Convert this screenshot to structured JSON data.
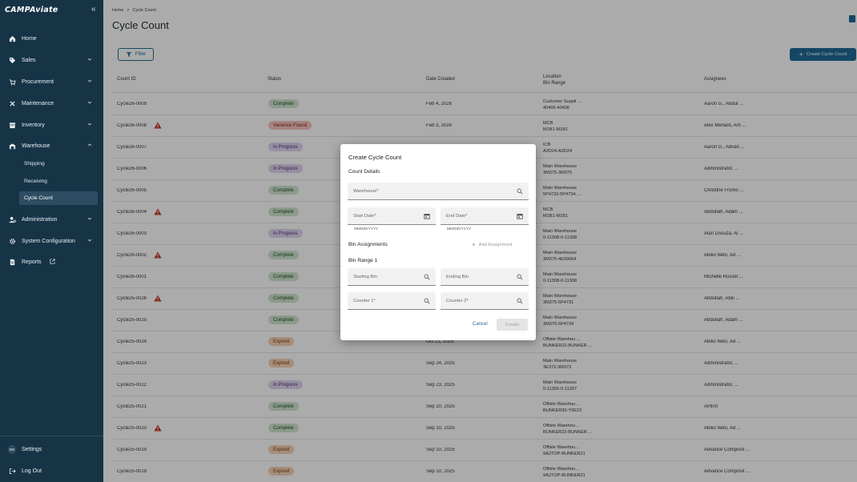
{
  "sidebar": {
    "logo_text": "CAMPAviate",
    "collapse_icon": "double-chevron-left-icon",
    "items": [
      {
        "label": "Home",
        "icon": "home-icon"
      },
      {
        "label": "Sales",
        "icon": "tag-icon"
      },
      {
        "label": "Procurement",
        "icon": "cart-icon"
      },
      {
        "label": "Maintenance",
        "icon": "tools-icon"
      },
      {
        "label": "Inventory",
        "icon": "inventory-icon"
      },
      {
        "label": "Warehouse",
        "icon": "warehouse-icon"
      }
    ],
    "warehouse_sub": [
      "Shipping",
      "Receiving",
      "Cycle Count"
    ],
    "items_after": [
      {
        "label": "Administration",
        "icon": "admin-icon"
      },
      {
        "label": "System Configuration",
        "icon": "gear-icon"
      },
      {
        "label": "Reports",
        "icon": "report-icon"
      }
    ],
    "settings_label": "Settings",
    "settings_avatar": "DS",
    "logout_label": "Log Out"
  },
  "breadcrumb": {
    "home": "Home",
    "sep": ">",
    "current": "Cycle Count"
  },
  "page_title": "Cycle Count",
  "toolbar": {
    "filter_label": "Filter",
    "create_label": "Create Cycle Count"
  },
  "table": {
    "headers": {
      "count_id": "Count ID",
      "status": "Status",
      "date_created": "Date Created",
      "location": "Location",
      "bin_range": "Bin Range",
      "assignees": "Assignees"
    },
    "rows": [
      {
        "id": "Cycle26-0009",
        "warn": false,
        "status": "Complete",
        "status_kind": "complete",
        "date": "Feb 4, 2026",
        "loc1": "Customer Suppli ...",
        "loc2": "40406-40406",
        "assignees": "Aaron G., Abdul ..."
      },
      {
        "id": "Cycle26-0008",
        "warn": true,
        "status": "Variance Found",
        "status_kind": "variance",
        "date": "Feb 3, 2026",
        "loc1": "MCB",
        "loc2": "M1B1-M1B1",
        "assignees": "Alex Menard, Am ..."
      },
      {
        "id": "Cycle26-0007",
        "warn": false,
        "status": "In Progress",
        "status_kind": "progress",
        "date": "",
        "loc1": "ICB",
        "loc2": "A2D24-A2D24",
        "assignees": "Aaron G., Advan ..."
      },
      {
        "id": "Cycle26-0006",
        "warn": false,
        "status": "In Progress",
        "status_kind": "progress",
        "date": "",
        "loc1": "Main Warehouse",
        "loc2": "3M375-3M375",
        "assignees": "Administrator, ..."
      },
      {
        "id": "Cycle26-0005",
        "warn": false,
        "status": "Complete",
        "status_kind": "complete",
        "date": "",
        "loc1": "Main Warehouse",
        "loc2": "5P4732-5P4734, ...",
        "assignees": "Christine Fromo ..."
      },
      {
        "id": "Cycle26-0004",
        "warn": true,
        "status": "Complete",
        "status_kind": "complete",
        "date": "",
        "loc1": "MCB",
        "loc2": "M1B1-M1B1",
        "assignees": "Abdullah, Adam ..."
      },
      {
        "id": "Cycle26-0003",
        "warn": false,
        "status": "In Progress",
        "status_kind": "progress",
        "date": "",
        "loc1": "Main Warehouse",
        "loc2": "0-11308-0-11308",
        "assignees": "Alan Dsouza, Al ..."
      },
      {
        "id": "Cycle26-0002",
        "warn": true,
        "status": "Complete",
        "status_kind": "complete",
        "date": "",
        "loc1": "Main Warehouse",
        "loc2": "3M375-4E99064",
        "assignees": "Abilio Neto, Ad ..."
      },
      {
        "id": "Cycle26-0001",
        "warn": false,
        "status": "Complete",
        "status_kind": "complete",
        "date": "",
        "loc1": "Main Warehouse",
        "loc2": "0-11308-0-11308",
        "assignees": "Michelle Russel ..."
      },
      {
        "id": "Cycle25-0026",
        "warn": true,
        "status": "Complete",
        "status_kind": "complete",
        "date": "",
        "loc1": "Main Warehouse",
        "loc2": "3M375-5P4731",
        "assignees": "Abdullah, Abili ..."
      },
      {
        "id": "Cycle25-0025",
        "warn": false,
        "status": "Complete",
        "status_kind": "complete",
        "date": "",
        "loc1": "Main Warehouse",
        "loc2": "3M375-5P4734",
        "assignees": "Abdullah, Adam ..."
      },
      {
        "id": "Cycle25-0024",
        "warn": false,
        "status": "Expired",
        "status_kind": "expired",
        "date": "Oct 21, 2025",
        "loc1": "Offsite Warehou ...",
        "loc2": "BUNKER22-BUNKER ...",
        "assignees": "Abilio Neto, Ad ..."
      },
      {
        "id": "Cycle25-0023",
        "warn": false,
        "status": "Expired",
        "status_kind": "expired",
        "date": "Sep 24, 2025",
        "loc1": "Main Warehouse",
        "loc2": "3E372-3M373",
        "assignees": "Administrator, ..."
      },
      {
        "id": "Cycle25-0022",
        "warn": false,
        "status": "In Progress",
        "status_kind": "progress",
        "date": "Sep 23, 2025",
        "loc1": "Main Warehouse",
        "loc2": "0-11305-0-11307",
        "assignees": "Administrator, ..."
      },
      {
        "id": "Cycle25-0021",
        "warn": false,
        "status": "Complete",
        "status_kind": "complete",
        "date": "Sep 10, 2025",
        "loc1": "Offsite Warehou ...",
        "loc2": "BUNKER30-Y9E23",
        "assignees": "Airfirst"
      },
      {
        "id": "Cycle25-0020",
        "warn": true,
        "status": "Complete",
        "status_kind": "complete",
        "date": "Sep 10, 2025",
        "loc1": "Offsite Warehou ...",
        "loc2": "BUNKER22-BUNKER ...",
        "assignees": "Abilio Neto, Ad ..."
      },
      {
        "id": "Cycle25-0019",
        "warn": false,
        "status": "Expired",
        "status_kind": "expired",
        "date": "Sep 10, 2025",
        "loc1": "Offsite Warehou ...",
        "loc2": "9A2TOP-BUNKER21",
        "assignees": "Advance Composit ..."
      },
      {
        "id": "Cycle25-0018",
        "warn": false,
        "status": "Expired",
        "status_kind": "expired",
        "date": "Sep 10, 2025",
        "loc1": "Offsite Warehou ...",
        "loc2": "9A2TOP-BUNKER21",
        "assignees": "Advance Composit ..."
      }
    ]
  },
  "modal": {
    "title": "Create Cycle Count",
    "count_details": "Count Details",
    "warehouse_placeholder": "Warehouse*",
    "start_date_placeholder": "Start Date*",
    "end_date_placeholder": "End Date*",
    "date_helper": "MM/DD/YYYY",
    "bin_assignments": "Bin Assignments",
    "add_assignment": "Add Assignment",
    "bin_range_1": "Bin Range 1",
    "starting_bin": "Starting Bin",
    "ending_bin": "Ending Bin",
    "counter_1": "Counter 1*",
    "counter_2": "Counter 2*",
    "cancel": "Cancel",
    "create": "Create"
  },
  "colors": {
    "sidebar_bg": "#173447",
    "accent": "#1f6b95"
  }
}
